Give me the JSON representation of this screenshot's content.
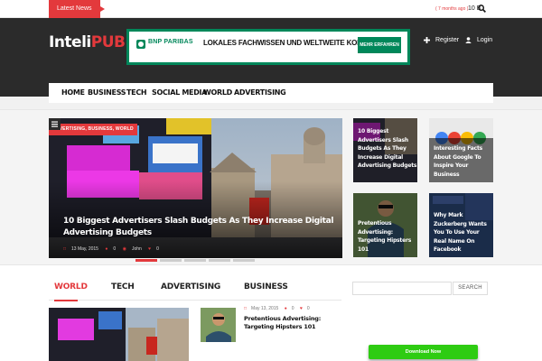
{
  "topbar": {
    "latest_label": "Latest News",
    "ticker_ago": "( 7 months ago )",
    "ticker_title": "10 B"
  },
  "header": {
    "logo_part1": "Inteli",
    "logo_part2": "PUB",
    "register_label": "Register",
    "login_label": "Login"
  },
  "ad": {
    "brand": "BNP PARIBAS",
    "headline": "LOKALES FACHWISSEN UND WELTWEITE KOMPETENZ",
    "button": "MEHR ERFAHREN"
  },
  "nav": {
    "items": [
      "HOME",
      "BUSINESS",
      "TECH",
      "SOCIAL MEDIA",
      "WORLD",
      "ADVERTISING"
    ]
  },
  "hero": {
    "categories": "ADVERTISING, BUSINESS, WORLD",
    "title": "10 Biggest Advertisers Slash Budgets As They Increase Digital Advertising Budgets",
    "date": "13 May, 2015",
    "comments": "0",
    "author": "John",
    "likes": "0"
  },
  "thumbs": [
    {
      "title": "10 Biggest Advertisers Slash Budgets As They Increase Digital Advertising Budgets"
    },
    {
      "title": "Interesting Facts About Google To Inspire Your Business"
    },
    {
      "title": "Pretentious Advertising: Targeting Hipsters 101"
    },
    {
      "title": "Why Mark Zuckerberg Wants You To Use Your Real Name On Facebook"
    }
  ],
  "tabs": [
    "WORLD",
    "TECH",
    "ADVERTISING",
    "BUSINESS"
  ],
  "post": {
    "date": "May 13, 2015",
    "comments": "0",
    "likes": "0",
    "title": "Pretentious Advertising: Targeting Hipsters 101"
  },
  "sidebar": {
    "search_placeholder": "",
    "search_button": "SEARCH",
    "download_button": "Download Now"
  },
  "colors": {
    "accent": "#e3393c",
    "header_bg": "#2b2b2b",
    "ad_green": "#00875a",
    "download_green": "#2ecc12"
  }
}
